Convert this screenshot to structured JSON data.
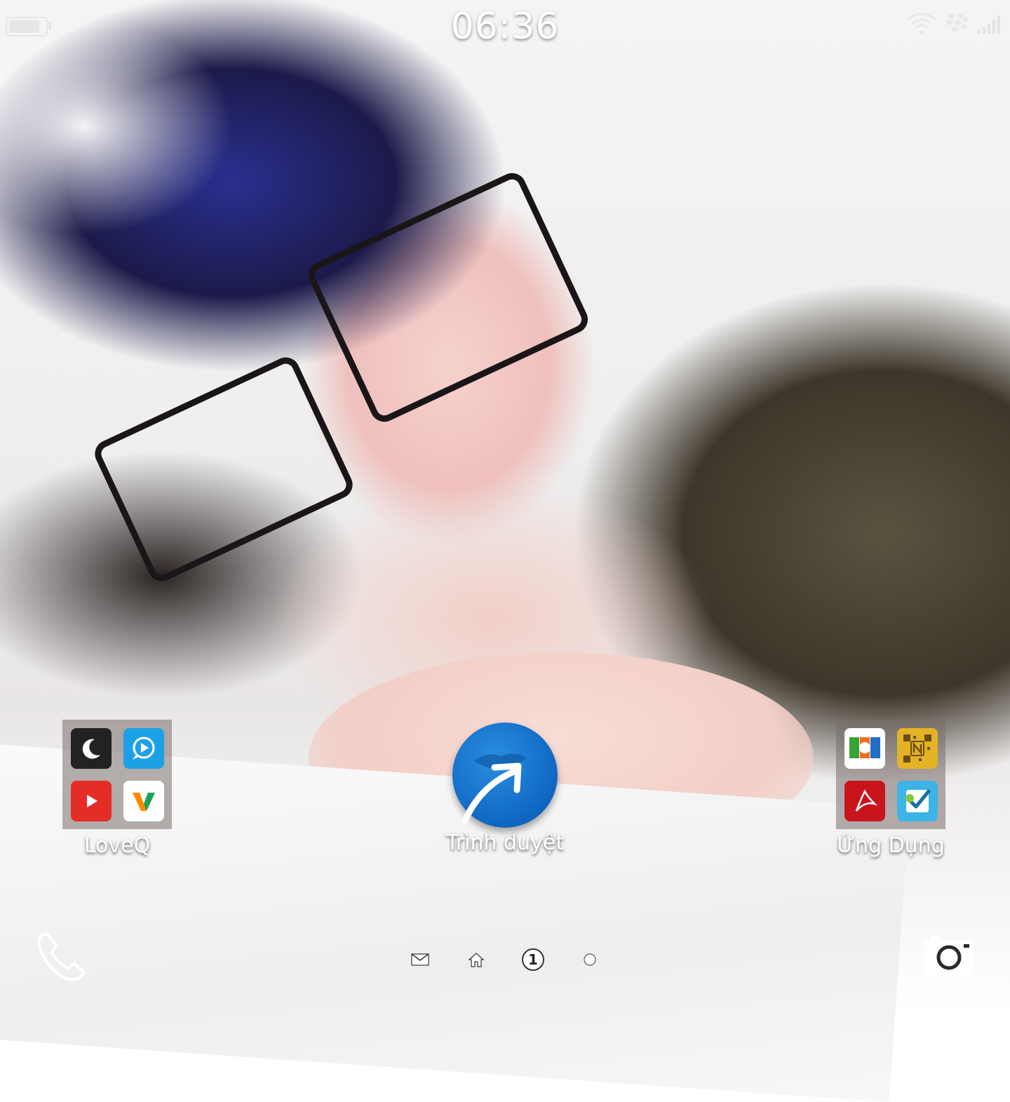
{
  "status_bar": {
    "time": "06:36",
    "battery_level": 0.9,
    "icons": [
      "battery-icon",
      "wifi-icon",
      "blackberry-logo-icon",
      "signal-bars-icon"
    ]
  },
  "home": {
    "tiles": [
      {
        "label": "LoveQ",
        "type": "folder",
        "apps": [
          "moon-app-icon",
          "chat-app-icon",
          "youtube-app-icon",
          "v-app-icon"
        ]
      },
      {
        "label": "Trình duyệt",
        "type": "app",
        "icon": "browser-globe-icon"
      },
      {
        "label": "Ứng Dụng",
        "type": "folder",
        "apps": [
          "docs-to-go-app-icon",
          "nfc-qr-app-icon",
          "adobe-reader-app-icon",
          "foursquare-app-icon"
        ]
      }
    ]
  },
  "dock": {
    "left_icon": "phone-icon",
    "right_icon": "camera-icon",
    "pager": {
      "items": [
        "hub-mail-icon",
        "home-icon",
        "page-1-indicator",
        "page-dot-icon"
      ],
      "current_page": "1"
    }
  },
  "colors": {
    "browser_blue": "#0f67c2",
    "youtube_red": "#e52d27",
    "reader_red": "#c8151b",
    "folder_bg": "#786e69"
  }
}
